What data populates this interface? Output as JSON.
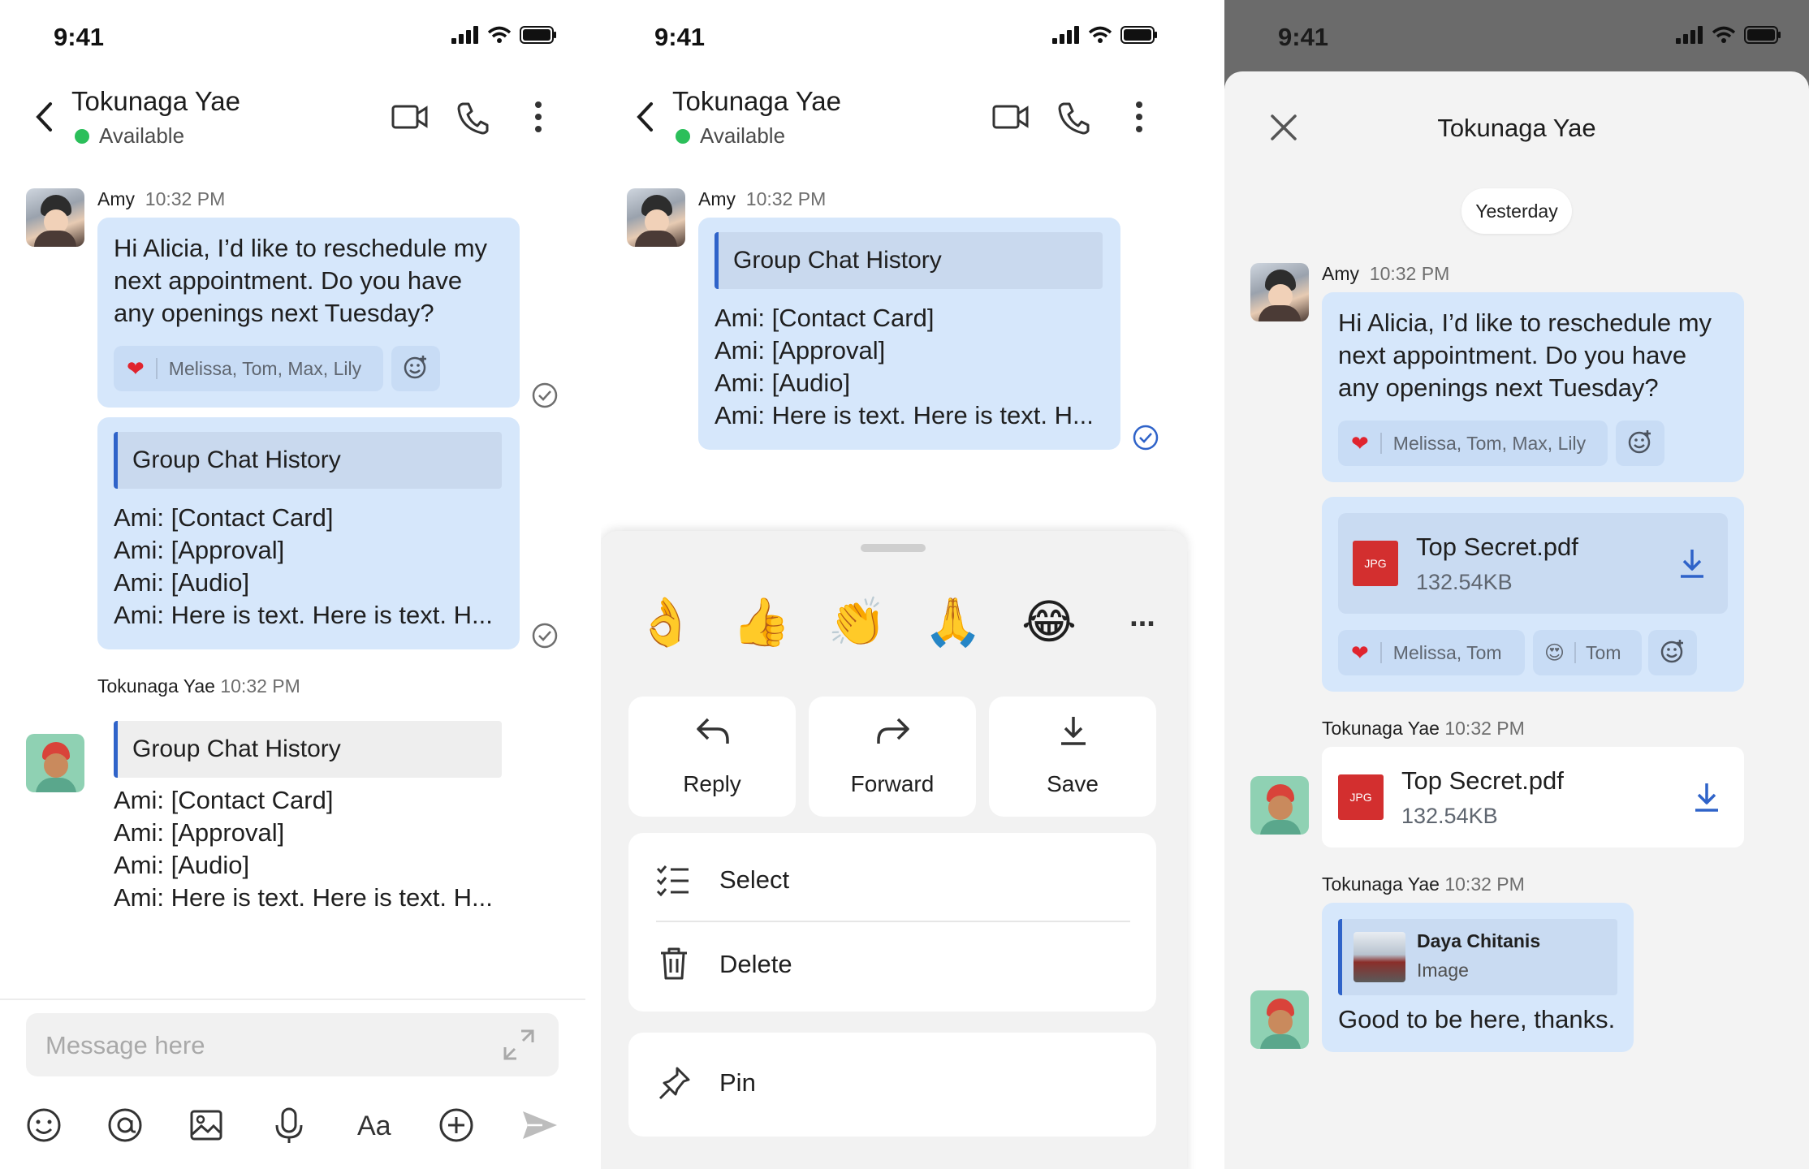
{
  "status": {
    "time": "9:41"
  },
  "header": {
    "name": "Tokunaga Yae",
    "status": "Available"
  },
  "pane1": {
    "msg1": {
      "sender": "Amy",
      "time": "10:32 PM",
      "lines": [
        "Hi Alicia, I’d like to reschedule my",
        "next appointment. Do you have",
        "any openings next Tuesday?"
      ],
      "reaction_users": "Melissa, Tom, Max, Lily"
    },
    "msg2": {
      "title": "Group Chat History",
      "lines": [
        "Ami: [Contact Card]",
        "Ami: [Approval]",
        "Ami: [Audio]",
        "Ami: Here is text. Here is text. H..."
      ]
    },
    "msg3": {
      "sender": "Tokunaga Yae",
      "time": "10:32 PM",
      "title": "Group Chat History",
      "lines": [
        "Ami: [Contact Card]",
        "Ami: [Approval]",
        "Ami: [Audio]",
        "Ami: Here is text. Here is text. H..."
      ]
    },
    "composer": {
      "placeholder": "Message here",
      "font_label": "Aa"
    }
  },
  "pane2": {
    "msg": {
      "sender": "Amy",
      "time": "10:32 PM",
      "title": "Group Chat History",
      "lines": [
        "Ami: [Contact Card]",
        "Ami: [Approval]",
        "Ami: [Audio]",
        "Ami: Here is text. Here is text. H..."
      ]
    },
    "emojis": [
      "👌",
      "👍",
      "👏",
      "🙏",
      "😂"
    ],
    "more": "...",
    "actions": [
      "Reply",
      "Forward",
      "Save"
    ],
    "menu": [
      "Select",
      "Delete"
    ],
    "pin": "Pin"
  },
  "pane3": {
    "title": "Tokunaga Yae",
    "date_chip": "Yesterday",
    "msg1": {
      "sender": "Amy",
      "time": "10:32 PM",
      "lines": [
        "Hi Alicia, I’d like to reschedule my",
        "next appointment. Do you have",
        "any openings next Tuesday?"
      ],
      "reaction_users": "Melissa, Tom, Max, Lily"
    },
    "file1": {
      "badge": "JPG",
      "name": "Top Secret.pdf",
      "size": "132.54KB",
      "reaction_a": "Melissa, Tom",
      "reaction_b": "Tom"
    },
    "msg2": {
      "sender": "Tokunaga Yae",
      "time": "10:32 PM",
      "badge": "JPG",
      "name": "Top Secret.pdf",
      "size": "132.54KB"
    },
    "msg3": {
      "sender": "Tokunaga Yae",
      "time": "10:32 PM",
      "quote_name": "Daya Chitanis",
      "quote_type": "Image",
      "text": "Good to be here, thanks."
    }
  },
  "colors": {
    "accent": "#2f63c9",
    "bubble": "#d6e7fb",
    "available": "#2bbf5a"
  }
}
